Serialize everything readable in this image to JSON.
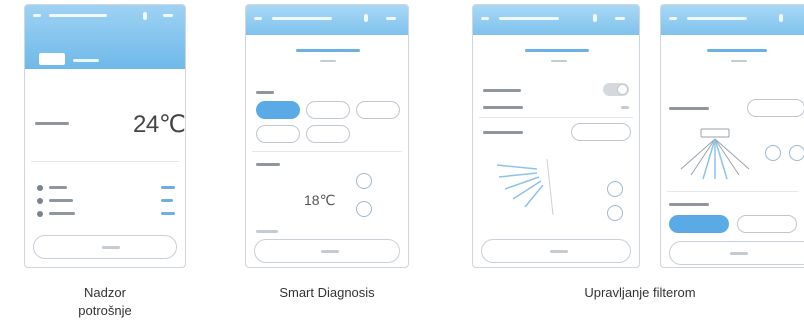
{
  "screens": {
    "nadzor": {
      "temperature": "24℃"
    },
    "smart": {
      "set_temp": "18℃"
    }
  },
  "captions": {
    "nadzor": "Nadzor\npotrošnje",
    "smart": "Smart Diagnosis",
    "filter": "Upravljanje filterom"
  },
  "colors": {
    "header_gradient": "#7fc2ec",
    "accent": "#5aaae6"
  },
  "icons": [
    "back-arrow-icon",
    "settings-icon",
    "close-icon",
    "power-icon"
  ]
}
